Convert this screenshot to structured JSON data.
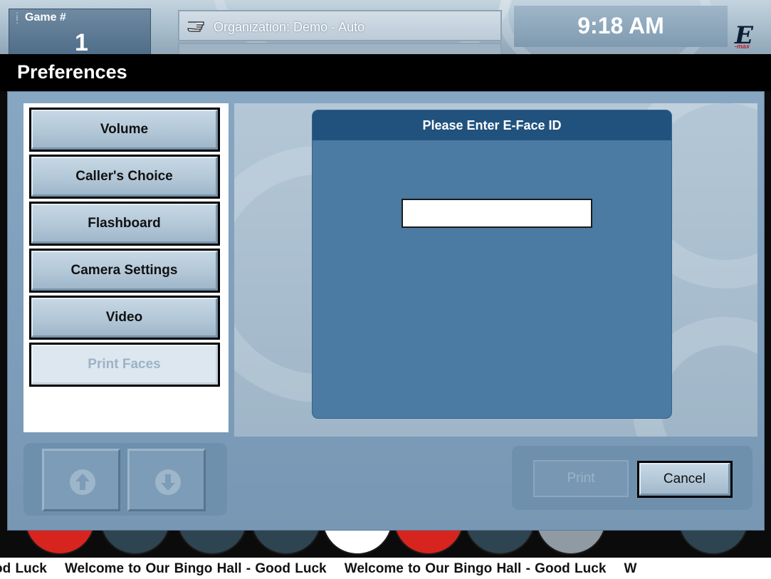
{
  "header": {
    "game_label": "Game #",
    "game_number": "1",
    "organization": "Organization: Demo - Auto",
    "time": "9:18 AM",
    "logo_letter": "E",
    "logo_sub": "-max"
  },
  "dialog": {
    "title": "Preferences",
    "menu": [
      {
        "label": "Volume",
        "enabled": true
      },
      {
        "label": "Caller's Choice",
        "enabled": true
      },
      {
        "label": "Flashboard",
        "enabled": true
      },
      {
        "label": "Camera Settings",
        "enabled": true
      },
      {
        "label": "Video",
        "enabled": true
      },
      {
        "label": "Print Faces",
        "enabled": false
      }
    ],
    "panel": {
      "heading": "Please Enter E-Face ID",
      "input_value": ""
    },
    "nav": {
      "up_icon": "arrow-up-circle-icon",
      "down_icon": "arrow-down-circle-icon"
    },
    "actions": {
      "print_label": "Print",
      "print_enabled": false,
      "cancel_label": "Cancel"
    }
  },
  "ticker": {
    "text": "od Luck    Welcome to Our Bingo Hall - Good Luck    Welcome to Our Bingo Hall - Good Luck    W"
  },
  "colors": {
    "title_bar": "#000000",
    "panel": "#4b7aa3",
    "panel_header": "#21527e",
    "dialog_bg": "#7797b4"
  }
}
